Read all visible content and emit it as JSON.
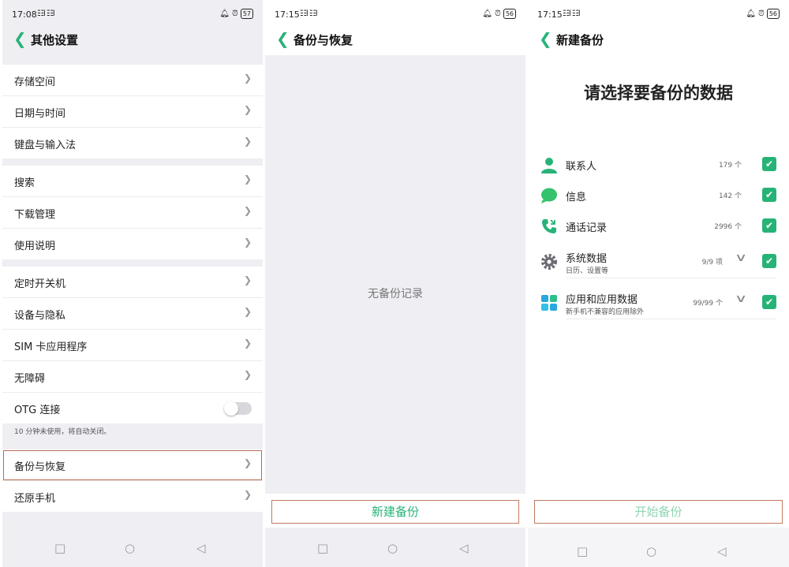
{
  "screen1": {
    "status": {
      "time": "17:08",
      "signal": "☷l ☷l",
      "battery": "57"
    },
    "title": "其他设置",
    "groups": [
      [
        "存储空间",
        "日期与时间",
        "键盘与输入法"
      ],
      [
        "搜索",
        "下载管理",
        "使用说明"
      ],
      [
        "定时开关机",
        "设备与隐私",
        "SIM 卡应用程序",
        "无障碍",
        "OTG 连接"
      ],
      [
        "备份与恢复",
        "还原手机"
      ]
    ],
    "otg_note": "10 分钟未使用，将自动关闭。",
    "otg_toggle_on": false,
    "highlighted_item": "备份与恢复"
  },
  "screen2": {
    "status": {
      "time": "17:15",
      "signal": "☷l ☷l",
      "battery": "56"
    },
    "title": "备份与恢复",
    "empty_text": "无备份记录",
    "button": "新建备份"
  },
  "screen3": {
    "status": {
      "time": "17:15",
      "signal": "☷l ☷l",
      "battery": "56"
    },
    "title": "新建备份",
    "heading": "请选择要备份的数据",
    "items": [
      {
        "name": "联系人",
        "count": "179 个",
        "checked": true,
        "icon": "contact-icon"
      },
      {
        "name": "信息",
        "count": "142 个",
        "checked": true,
        "icon": "message-icon"
      },
      {
        "name": "通话记录",
        "count": "2996 个",
        "checked": true,
        "icon": "phone-call-icon"
      },
      {
        "name": "系统数据",
        "sub": "日历、设置等",
        "count": "9/9 项",
        "checked": true,
        "icon": "gear-icon"
      },
      {
        "name": "应用和应用数据",
        "sub": "新手机不兼容的应用除外",
        "count": "99/99 个",
        "checked": true,
        "icon": "apps-icon"
      }
    ],
    "button": "开始备份"
  },
  "nav_keys": {
    "square": "□",
    "circle": "○",
    "back": "◁"
  },
  "icons": {
    "back": "❮",
    "chevron": "❯",
    "check": "✔",
    "expand": "∨"
  },
  "colors": {
    "accent": "#27b377",
    "highlight_border": "#b56b55",
    "page_bg": "#efeef3"
  }
}
